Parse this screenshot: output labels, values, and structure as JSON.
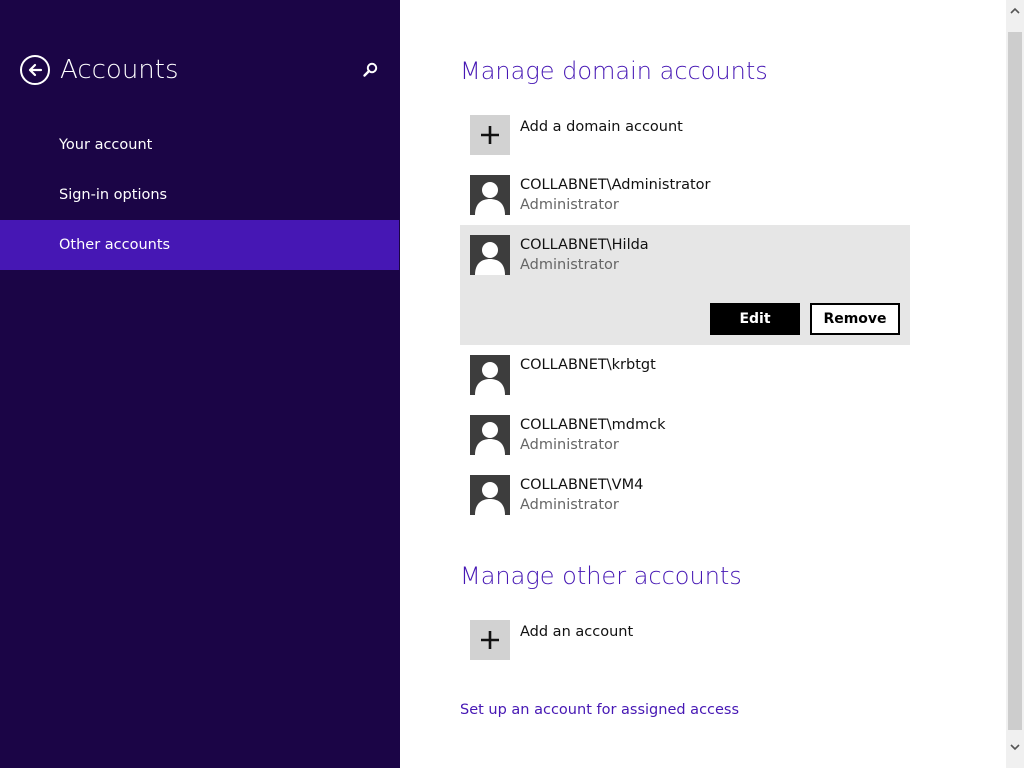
{
  "sidebar": {
    "title": "Accounts",
    "items": [
      {
        "label": "Your account"
      },
      {
        "label": "Sign-in options"
      },
      {
        "label": "Other accounts"
      }
    ]
  },
  "domain": {
    "title": "Manage domain accounts",
    "add_label": "Add a domain account",
    "accounts": [
      {
        "name": "COLLABNET\\Administrator",
        "role": "Administrator"
      },
      {
        "name": "COLLABNET\\Hilda",
        "role": "Administrator"
      },
      {
        "name": "COLLABNET\\krbtgt",
        "role": ""
      },
      {
        "name": "COLLABNET\\mdmck",
        "role": "Administrator"
      },
      {
        "name": "COLLABNET\\VM4",
        "role": "Administrator"
      }
    ],
    "edit_label": "Edit",
    "remove_label": "Remove"
  },
  "other": {
    "title": "Manage other accounts",
    "add_label": "Add an account",
    "assigned_access_link": "Set up an account for assigned access"
  },
  "icons": {
    "back": "back-arrow-icon",
    "search": "search-icon",
    "plus": "plus-icon",
    "avatar": "user-avatar-icon"
  },
  "colors": {
    "sidebar_bg": "#1b0546",
    "accent": "#4617b4",
    "tile": "#d2d2d2",
    "avatar_bg": "#3d3d3d"
  }
}
